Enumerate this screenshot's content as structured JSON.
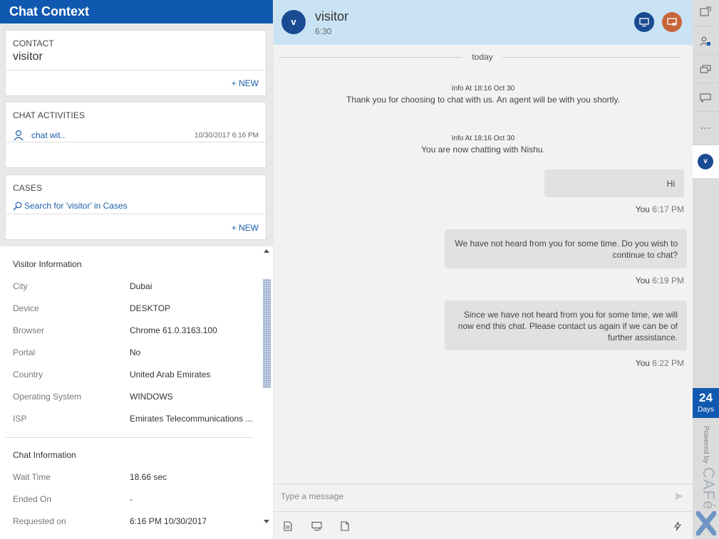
{
  "left_panel": {
    "title": "Chat Context",
    "contact": {
      "title": "CONTACT",
      "value": "visitor",
      "new_label": "+ NEW"
    },
    "chat_activities": {
      "title": "CHAT ACTIVITIES",
      "item_name": "chat wit..",
      "item_date": "10/30/2017 6:16 PM"
    },
    "cases": {
      "title": "CASES",
      "search_label": "Search for 'visitor' in Cases",
      "new_label": "+ NEW"
    },
    "visitor_information": {
      "title": "Visitor Information",
      "rows": [
        {
          "label": "City",
          "value": "Dubai"
        },
        {
          "label": "Device",
          "value": "DESKTOP"
        },
        {
          "label": "Browser",
          "value": "Chrome 61.0.3163.100"
        },
        {
          "label": "Portal",
          "value": "No"
        },
        {
          "label": "Country",
          "value": "United Arab Emirates"
        },
        {
          "label": "Operating System",
          "value": "WINDOWS"
        },
        {
          "label": "ISP",
          "value": "Emirates Telecommunications ..."
        }
      ]
    },
    "chat_information": {
      "title": "Chat Information",
      "rows": [
        {
          "label": "Wait Time",
          "value": "18.66 sec"
        },
        {
          "label": "Ended On",
          "value": "-"
        },
        {
          "label": "Requested on",
          "value": "6:16 PM 10/30/2017"
        }
      ]
    }
  },
  "chat": {
    "avatar_letter": "v",
    "name": "visitor",
    "duration": "6:30",
    "day_label": "today",
    "info_messages": [
      {
        "meta": "Info At 18:16 Oct 30",
        "text": "Thank you for choosing to chat with us. An agent will be with you shortly."
      },
      {
        "meta": "Info At 18:16 Oct 30",
        "text": "You are now chatting with Nishu."
      }
    ],
    "messages": [
      {
        "lines": [
          "Hi"
        ],
        "sender": "You",
        "time": "6:17 PM"
      },
      {
        "lines": [
          "We have not heard from you for some time. Do you wish to",
          "continue to chat?"
        ],
        "sender": "You",
        "time": "6:19 PM"
      },
      {
        "lines": [
          "Since we have not heard from you for some time, we will",
          "now end this chat. Please contact us again if we can be of",
          "further assistance."
        ],
        "sender": "You",
        "time": "6:22 PM"
      }
    ],
    "input_placeholder": "Type a message"
  },
  "rail": {
    "avatar_letter": "v",
    "days_number": "24",
    "days_label": "Days",
    "powered_by": "Powered by",
    "brand": "CAFé"
  },
  "colors": {
    "header_blue": "#1059b0",
    "chat_header_bg": "#c9e3f5",
    "avatar_blue": "#1a4b92",
    "end_chat_orange": "#c8643a",
    "link_blue": "#1d5fa8"
  },
  "icons": [
    "search-icon",
    "person-icon",
    "monitor-icon",
    "end-chat-icon",
    "send-icon",
    "notes-icon",
    "screen-share-icon",
    "file-icon",
    "lightning-icon",
    "popout-icon",
    "customer-icon",
    "chat-bubbles-icon",
    "chat-bubble-icon",
    "more-icon",
    "cafex-logo-icon"
  ]
}
